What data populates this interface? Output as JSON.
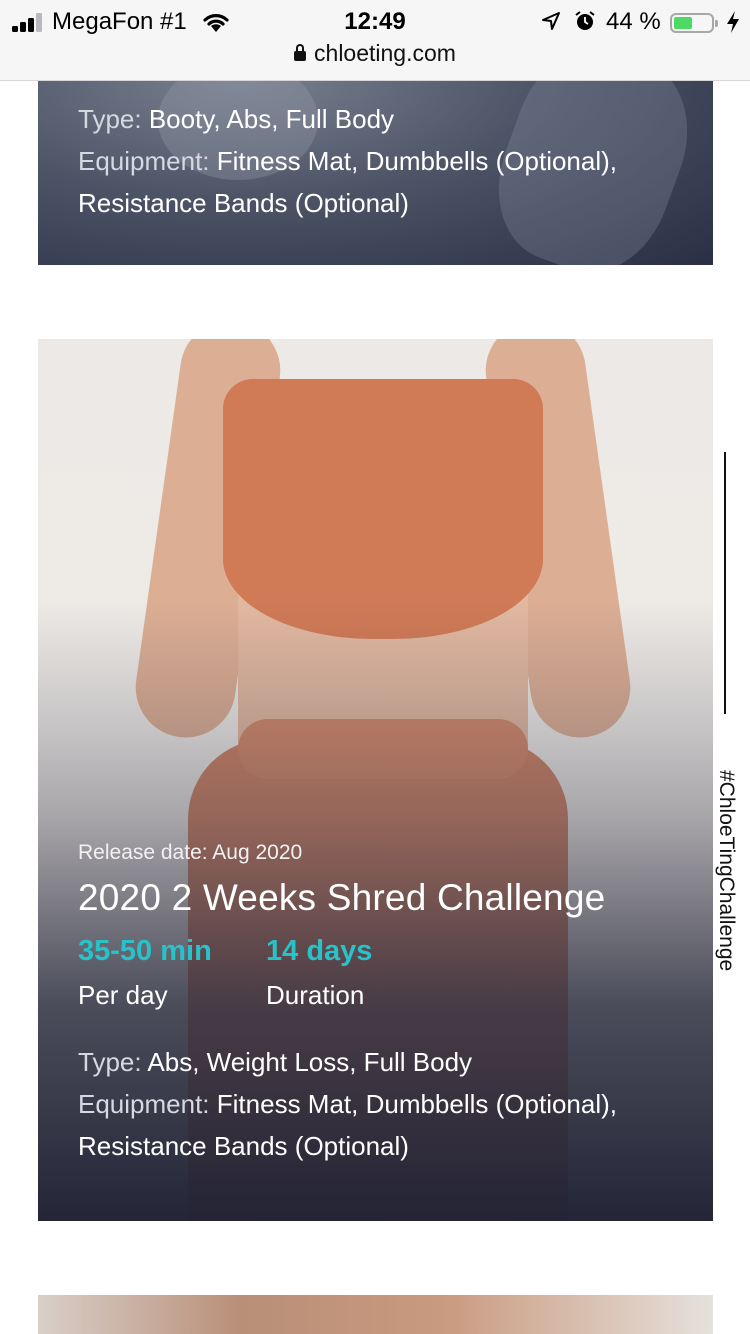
{
  "status_bar": {
    "carrier": "MegaFon #1",
    "time": "12:49",
    "battery_percent": "44 %",
    "battery_level": 0.44,
    "url": "chloeting.com"
  },
  "cards": [
    {
      "type_label": "Type:",
      "type_value": "Booty, Abs, Full Body",
      "equipment_label": "Equipment:",
      "equipment_value_1": "Fitness Mat, Dumbbells (Optional),",
      "equipment_value_2": "Resistance Bands (Optional)"
    },
    {
      "release_date": "Release date: Aug 2020",
      "title": "2020 2 Weeks Shred Challenge",
      "stats": [
        {
          "value": "35-50 min",
          "caption": "Per day"
        },
        {
          "value": "14 days",
          "caption": "Duration"
        }
      ],
      "type_label": "Type:",
      "type_value": "Abs, Weight Loss, Full Body",
      "equipment_label": "Equipment:",
      "equipment_value_1": "Fitness Mat, Dumbbells (Optional),",
      "equipment_value_2": "Resistance Bands (Optional)"
    }
  ],
  "side_hashtag": "#ChloeTingChallenge",
  "colors": {
    "accent": "#27c3c9",
    "overlay": "#2a2f44"
  }
}
